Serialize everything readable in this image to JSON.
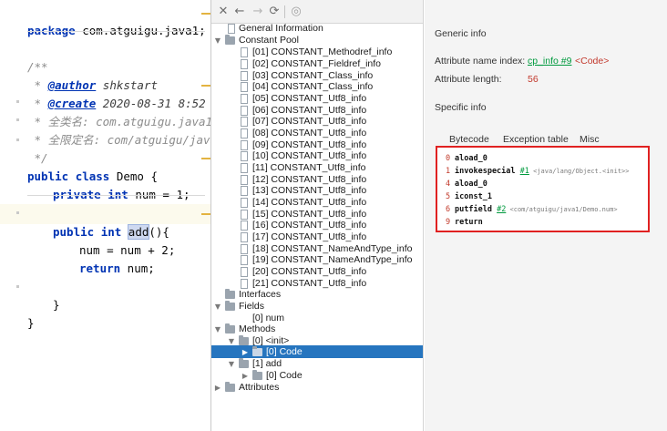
{
  "editor": {
    "lines": {
      "package": {
        "kw": "package",
        "rest": " com.atguigu.java1;"
      },
      "doc_open": "/**",
      "author": {
        "prefix": " * ",
        "tag": "@author",
        "value": " shkstart"
      },
      "create": {
        "prefix": " * ",
        "tag": "@create",
        "value": " 2020-08-31 8:52"
      },
      "classname": " * 全类名: com.atguigu.java1.",
      "fullname": " * 全限定名: com/atguigu/java",
      "doc_close": " */",
      "class_decl": {
        "kw1": "public",
        "kw2": "class",
        "name": " Demo {"
      },
      "field": {
        "kw1": "private",
        "kw2": "int",
        "rest": " num = 1;"
      },
      "method": {
        "kw1": "public",
        "kw2": "int",
        "name": "add",
        "rest": "(){"
      },
      "assign": "num = num + 2;",
      "ret": {
        "kw": "return",
        "rest": " num;"
      },
      "close1": "}",
      "close2": "}"
    }
  },
  "toolbar": {
    "close": "✕",
    "back": "←",
    "forward": "→",
    "refresh": "⟳",
    "web": "◎"
  },
  "tree": {
    "general_info": "General Information",
    "constant_pool": "Constant Pool",
    "constants": [
      "[01] CONSTANT_Methodref_info",
      "[02] CONSTANT_Fieldref_info",
      "[03] CONSTANT_Class_info",
      "[04] CONSTANT_Class_info",
      "[05] CONSTANT_Utf8_info",
      "[06] CONSTANT_Utf8_info",
      "[07] CONSTANT_Utf8_info",
      "[08] CONSTANT_Utf8_info",
      "[09] CONSTANT_Utf8_info",
      "[10] CONSTANT_Utf8_info",
      "[11] CONSTANT_Utf8_info",
      "[12] CONSTANT_Utf8_info",
      "[13] CONSTANT_Utf8_info",
      "[14] CONSTANT_Utf8_info",
      "[15] CONSTANT_Utf8_info",
      "[16] CONSTANT_Utf8_info",
      "[17] CONSTANT_Utf8_info",
      "[18] CONSTANT_NameAndType_info",
      "[19] CONSTANT_NameAndType_info",
      "[20] CONSTANT_Utf8_info",
      "[21] CONSTANT_Utf8_info"
    ],
    "interfaces": "Interfaces",
    "fields": "Fields",
    "field_num": "[0] num",
    "methods": "Methods",
    "method_init": "[0] <init>",
    "code_init": "[0] Code",
    "method_add": "[1] add",
    "code_add": "[0] Code",
    "attributes": "Attributes"
  },
  "info": {
    "generic_title": "Generic info",
    "attr_name_label": "Attribute name index:",
    "attr_name_link": "cp_info #9",
    "attr_name_value": "<Code>",
    "attr_len_label": "Attribute length:",
    "attr_len_value": "56",
    "specific_title": "Specific info",
    "tabs": {
      "bytecode": "Bytecode",
      "exception": "Exception table",
      "misc": "Misc"
    },
    "bytecode": [
      {
        "off": "0",
        "op": "aload_0",
        "arg": "",
        "cmt": ""
      },
      {
        "off": "1",
        "op": "invokespecial",
        "arg": "#1",
        "cmt": " <java/lang/Object.<init>>"
      },
      {
        "off": "4",
        "op": "aload_0",
        "arg": "",
        "cmt": ""
      },
      {
        "off": "5",
        "op": "iconst_1",
        "arg": "",
        "cmt": ""
      },
      {
        "off": "6",
        "op": "putfield",
        "arg": "#2",
        "cmt": " <com/atguigu/java1/Demo.num>"
      },
      {
        "off": "9",
        "op": "return",
        "arg": "",
        "cmt": ""
      }
    ]
  },
  "colors": {
    "highlight_box": "#e02121",
    "selection": "#2675bf",
    "link": "#009a3e"
  }
}
